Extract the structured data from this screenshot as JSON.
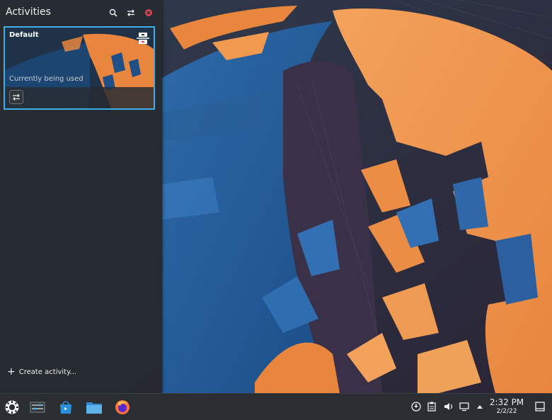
{
  "activities_panel": {
    "title": "Activities",
    "create_label": "Create activity...",
    "activities": [
      {
        "name": "Default",
        "status": "Currently being used"
      }
    ]
  },
  "taskbar": {
    "clock_time": "2:32 PM",
    "clock_date": "2/2/22"
  },
  "icons": {
    "search": "search-icon",
    "switch": "switch-icon",
    "close": "close-icon",
    "stop": "stop-activity-icon",
    "configure": "configure-icon",
    "add": "plus-icon",
    "launcher": "app-launcher-icon",
    "pager": "pager-icon",
    "store": "discover-store-icon",
    "files": "file-manager-icon",
    "browser": "firefox-icon",
    "network": "network-icon",
    "clipboard": "clipboard-icon",
    "volume": "volume-icon",
    "display": "display-icon",
    "tray_expand": "chevron-up-icon",
    "show_desktop": "show-desktop-icon"
  },
  "colors": {
    "accent": "#3daee9",
    "close": "#da4453",
    "panel_bg": "#262a2f",
    "taskbar_bg": "#2a2e32"
  }
}
